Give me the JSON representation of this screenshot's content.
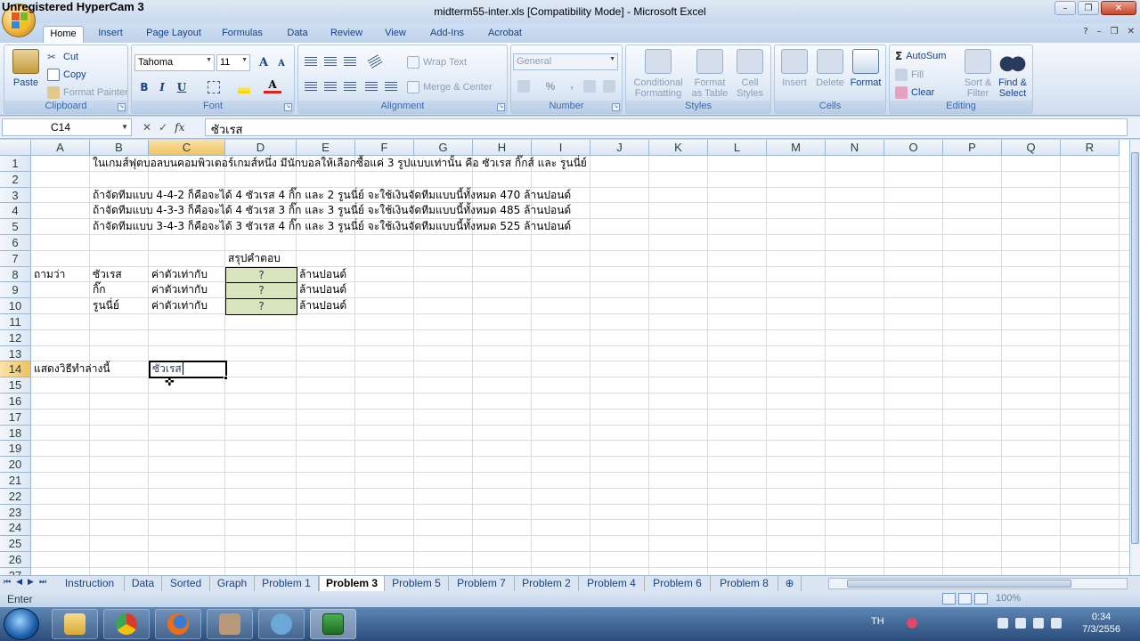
{
  "watermark": "Unregistered HyperCam 3",
  "window": {
    "title": "midterm55-inter.xls  [Compatibility Mode] - Microsoft Excel"
  },
  "tabs": [
    "Home",
    "Insert",
    "Page Layout",
    "Formulas",
    "Data",
    "Review",
    "View",
    "Add-Ins",
    "Acrobat"
  ],
  "ribbon": {
    "clipboard": {
      "paste": "Paste",
      "cut": "Cut",
      "copy": "Copy",
      "format_painter": "Format Painter",
      "label": "Clipboard"
    },
    "font": {
      "name": "Tahoma",
      "size": "11",
      "bold": "B",
      "italic": "I",
      "underline": "U",
      "grow": "A",
      "shrink": "A",
      "color_a": "A",
      "label": "Font"
    },
    "alignment": {
      "wrap_text": "Wrap Text",
      "merge": "Merge & Center",
      "label": "Alignment"
    },
    "number": {
      "format": "General",
      "percent": "%",
      "comma": ",",
      "label": "Number"
    },
    "styles": {
      "conditional": "Conditional Formatting",
      "format_table": "Format as Table",
      "cell_styles": "Cell Styles",
      "label": "Styles"
    },
    "cells": {
      "insert": "Insert",
      "delete": "Delete",
      "format": "Format",
      "label": "Cells"
    },
    "editing": {
      "autosum": "AutoSum",
      "fill": "Fill",
      "clear": "Clear",
      "sort": "Sort & Filter",
      "find": "Find & Select",
      "label": "Editing"
    }
  },
  "formula_bar": {
    "name_box": "C14",
    "content": "ซัวเรส"
  },
  "columns": [
    "A",
    "B",
    "C",
    "D",
    "E",
    "F",
    "G",
    "H",
    "I",
    "J",
    "K",
    "L",
    "M",
    "N",
    "O",
    "P",
    "Q",
    "R"
  ],
  "rows": [
    "1",
    "2",
    "3",
    "4",
    "5",
    "6",
    "7",
    "8",
    "9",
    "10",
    "11",
    "12",
    "13",
    "14",
    "15",
    "16",
    "17",
    "18",
    "19",
    "20",
    "21",
    "22",
    "23",
    "24",
    "25",
    "26",
    "27"
  ],
  "cells": {
    "B1": "ในเกมส์ฟุตบอลบนคอมพิวเตอร์เกมส์หนึ่ง  มีนักบอลให้เลือกซื้อแค่ 3 รูปแบบเท่านั้น คือ ซัวเรส กิ๊กส์ และ รูนนี่ย์",
    "B3": "ถ้าจัดทีมแบบ 4-4-2  ก็คือจะได้ 4  ซัวเรส 4 กิ๊ก และ 2 รูนนี่ย์  จะใช้เงินจัดทีมแบบนี้ทั้งหมด 470 ล้านปอนด์",
    "B4": "ถ้าจัดทีมแบบ 4-3-3  ก็คือจะได้ 4  ซัวเรส 3 กิ๊ก และ 3 รูนนี่ย์  จะใช้เงินจัดทีมแบบนี้ทั้งหมด 485 ล้านปอนด์",
    "B5": "ถ้าจัดทีมแบบ 3-4-3  ก็คือจะได้ 3  ซัวเรส 4 กิ๊ก และ 3 รูนนี่ย์  จะใช้เงินจัดทีมแบบนี้ทั้งหมด  525 ล้านปอนด์",
    "D7": "สรุปคำตอบ",
    "A8": "ถามว่า",
    "B8": "ซัวเรส",
    "C8": "ค่าตัวเท่ากับ",
    "D8": "?",
    "E8": "ล้านปอนด์",
    "B9": "กิ๊ก",
    "C9": "ค่าตัวเท่ากับ",
    "D9": "?",
    "E9": "ล้านปอนด์",
    "B10": "รูนนี่ย์",
    "C10": "ค่าตัวเท่ากับ",
    "D10": "?",
    "E10": "ล้านปอนด์",
    "A14": "แสดงวิธีทำล่างนี้",
    "C14": "ซัวเรส"
  },
  "sheet_tabs": [
    "Instruction",
    "Data",
    "Sorted",
    "Graph",
    "Problem 1",
    "Problem 3",
    "Problem 5",
    "Problem 7",
    "Problem 2",
    "Problem 4",
    "Problem 6",
    "Problem 8"
  ],
  "active_sheet": "Problem 3",
  "status": {
    "mode": "Enter",
    "zoom": "100%"
  },
  "taskbar": {
    "lang": "TH",
    "time": "0:34",
    "date": "7/3/2556"
  }
}
